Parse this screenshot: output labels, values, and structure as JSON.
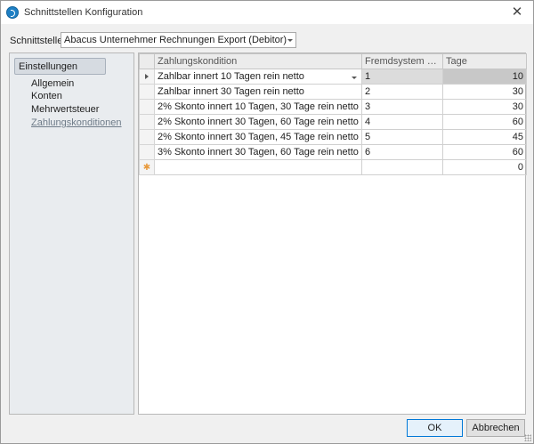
{
  "window": {
    "title": "Schnittstellen Konfiguration",
    "close_glyph": "✕"
  },
  "schnittstelle": {
    "label": "Schnittstelle",
    "selected": "Abacus Unternehmer Rechnungen Export (Debitor)"
  },
  "sidebar": {
    "header": "Einstellungen",
    "items": [
      {
        "label": "Allgemein"
      },
      {
        "label": "Konten"
      },
      {
        "label": "Mehrwertsteuer"
      },
      {
        "label": "Zahlungskonditionen"
      }
    ]
  },
  "grid": {
    "columns": [
      "Zahlungskondition",
      "Fremdsystem Schlü...",
      "Tage"
    ],
    "rows": [
      {
        "kondition": "Zahlbar innert 10 Tagen rein netto",
        "key": "1",
        "tage": "10"
      },
      {
        "kondition": "Zahlbar innert 30 Tagen rein netto",
        "key": "2",
        "tage": "30"
      },
      {
        "kondition": "2% Skonto innert 10 Tagen, 30 Tage rein netto",
        "key": "3",
        "tage": "30"
      },
      {
        "kondition": "2% Skonto innert 30 Tagen, 60 Tage rein netto",
        "key": "4",
        "tage": "60"
      },
      {
        "kondition": "2% Skonto innert 30 Tagen, 45 Tage rein netto",
        "key": "5",
        "tage": "45"
      },
      {
        "kondition": "3% Skonto innert 30 Tagen, 60 Tage rein netto",
        "key": "6",
        "tage": "60"
      }
    ],
    "new_row": {
      "kondition": "",
      "key": "",
      "tage": "0",
      "marker": "✱"
    }
  },
  "buttons": {
    "ok": "OK",
    "cancel": "Abbrechen"
  }
}
